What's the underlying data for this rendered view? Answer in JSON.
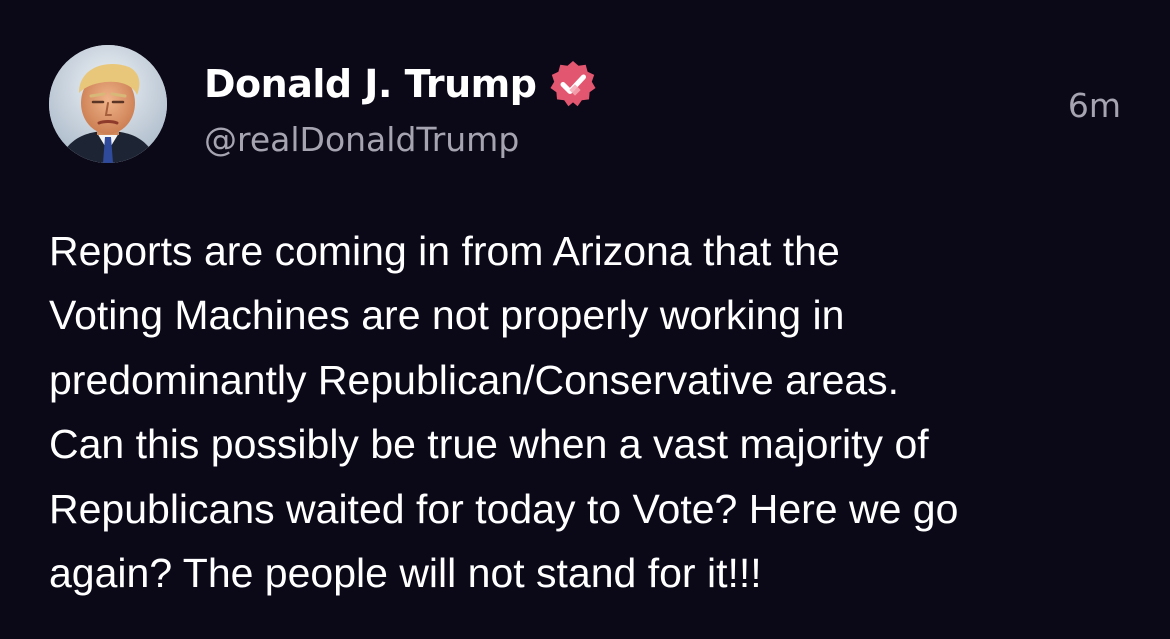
{
  "post": {
    "author": {
      "display_name": "Donald J. Trump",
      "handle": "@realDonaldTrump",
      "verified_icon": "verified-badge-icon",
      "avatar_icon": "avatar"
    },
    "timestamp": "6m",
    "body_lines": [
      "Reports are coming in from Arizona that the",
      "Voting Machines are not properly working in",
      "predominantly Republican/Conservative areas.",
      "Can this possibly be true when a vast majority of",
      "Republicans waited for today to Vote? Here we go",
      "again? The people will not stand for it!!!"
    ]
  },
  "colors": {
    "background": "#0b0818",
    "text_primary": "#ffffff",
    "text_secondary": "#a6a4b0",
    "verified_badge": "#e3566f"
  }
}
